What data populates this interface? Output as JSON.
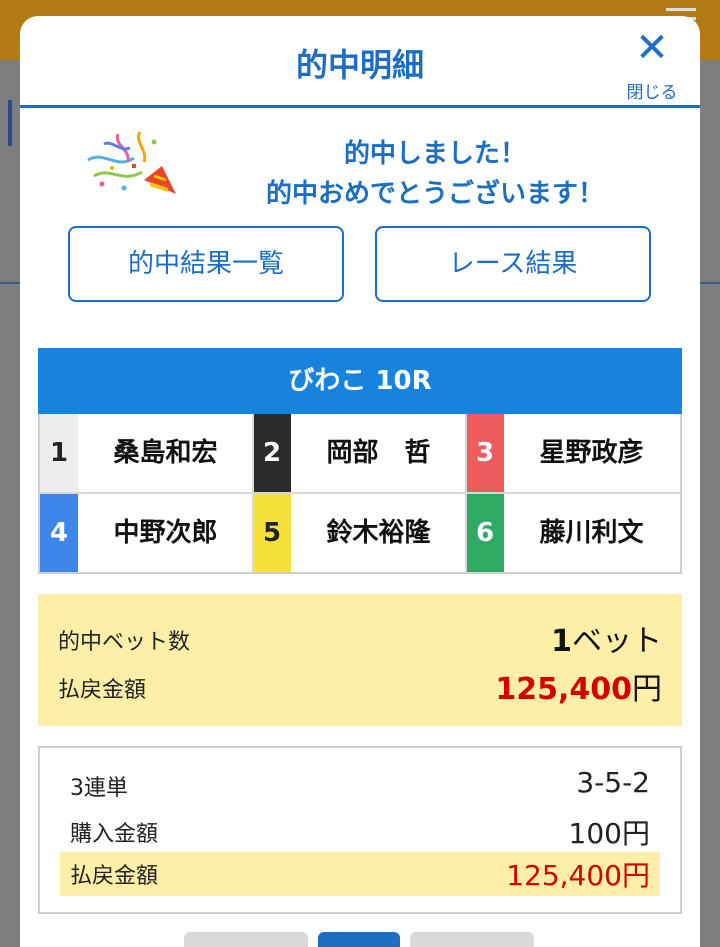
{
  "modal": {
    "title": "的中明細",
    "close_label": "閉じる"
  },
  "congrats": {
    "line1": "的中しました！",
    "line2": "的中おめでとうございます！"
  },
  "buttons": {
    "hit_list": "的中結果一覧",
    "race_result": "レース結果"
  },
  "race": {
    "title": "びわこ 10R",
    "racers": [
      {
        "num": "1",
        "name": "桑島和宏",
        "color": "#eeeeee",
        "text_color": "#222222"
      },
      {
        "num": "2",
        "name": "岡部　哲",
        "color": "#2b2b2b",
        "text_color": "#ffffff"
      },
      {
        "num": "3",
        "name": "星野政彦",
        "color": "#ee5d5d",
        "text_color": "#ffffff"
      },
      {
        "num": "4",
        "name": "中野次郎",
        "color": "#3f86ec",
        "text_color": "#ffffff"
      },
      {
        "num": "5",
        "name": "鈴木裕隆",
        "color": "#f5e03c",
        "text_color": "#222222"
      },
      {
        "num": "6",
        "name": "藤川利文",
        "color": "#2eaa62",
        "text_color": "#ffffff"
      }
    ]
  },
  "summary": {
    "bets_label": "的中ベット数",
    "bets_count": "1",
    "bets_unit": "ベット",
    "payout_label": "払戻金額",
    "payout_amount": "125,400",
    "payout_unit": "円"
  },
  "detail": {
    "bet_type": "3連単",
    "combination": "3-5-2",
    "purchase_label": "購入金額",
    "purchase_amount": "100円",
    "payout_label": "払戻金額",
    "payout_amount": "125,400円"
  },
  "colors": {
    "accent": "#1b6ec2",
    "header_bar": "#1783df",
    "highlight": "#fdefa8",
    "money": "#d40000"
  }
}
